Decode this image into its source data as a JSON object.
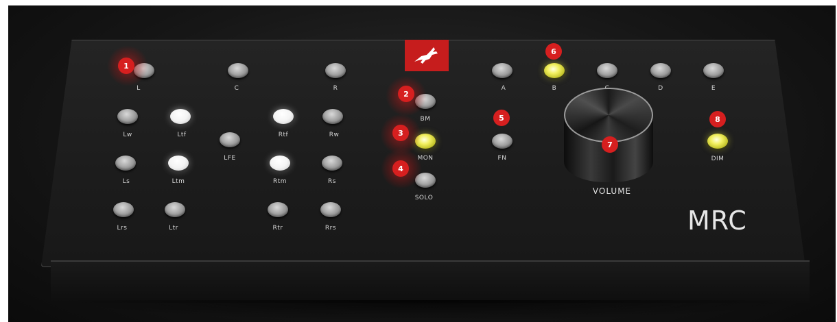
{
  "device": {
    "model_label": "MRC",
    "brand_logo_icon": "antelope-logo-icon",
    "brand_color": "#c61d1d",
    "volume_label": "VOLUME"
  },
  "speaker_buttons": [
    {
      "id": "L",
      "label": "L",
      "state": "off"
    },
    {
      "id": "C",
      "label": "C",
      "state": "off"
    },
    {
      "id": "R",
      "label": "R",
      "state": "off"
    },
    {
      "id": "Lw",
      "label": "Lw",
      "state": "off"
    },
    {
      "id": "Ltf",
      "label": "Ltf",
      "state": "white"
    },
    {
      "id": "LFE",
      "label": "LFE",
      "state": "off"
    },
    {
      "id": "Rtf",
      "label": "Rtf",
      "state": "white"
    },
    {
      "id": "Rw",
      "label": "Rw",
      "state": "off"
    },
    {
      "id": "Ls",
      "label": "Ls",
      "state": "off"
    },
    {
      "id": "Ltm",
      "label": "Ltm",
      "state": "white"
    },
    {
      "id": "Rtm",
      "label": "Rtm",
      "state": "white"
    },
    {
      "id": "Rs",
      "label": "Rs",
      "state": "off"
    },
    {
      "id": "Lrs",
      "label": "Lrs",
      "state": "off"
    },
    {
      "id": "Ltr",
      "label": "Ltr",
      "state": "off"
    },
    {
      "id": "Rtr",
      "label": "Rtr",
      "state": "off"
    },
    {
      "id": "Rrs",
      "label": "Rrs",
      "state": "off"
    }
  ],
  "mode_buttons": [
    {
      "id": "BM",
      "label": "BM",
      "state": "off"
    },
    {
      "id": "MON",
      "label": "MON",
      "state": "yellow"
    },
    {
      "id": "SOLO",
      "label": "SOLO",
      "state": "off"
    },
    {
      "id": "FN",
      "label": "FN",
      "state": "off"
    },
    {
      "id": "DIM",
      "label": "DIM",
      "state": "yellow"
    }
  ],
  "source_buttons": [
    {
      "id": "A",
      "label": "A",
      "state": "off"
    },
    {
      "id": "B",
      "label": "B",
      "state": "yellow"
    },
    {
      "id": "C2",
      "label": "C",
      "state": "off"
    },
    {
      "id": "D",
      "label": "D",
      "state": "off"
    },
    {
      "id": "E",
      "label": "E",
      "state": "off"
    }
  ],
  "callouts": [
    "1",
    "2",
    "3",
    "4",
    "5",
    "6",
    "7",
    "8"
  ],
  "colors": {
    "callout_red": "#d61f1f",
    "led_white": "#ffffff",
    "led_yellow": "#f2f060",
    "button_grey": "#a5a5a5"
  }
}
